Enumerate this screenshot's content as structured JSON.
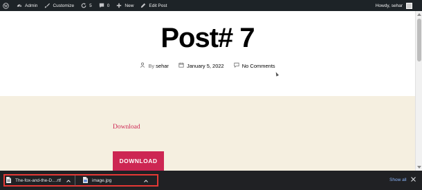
{
  "admin_bar": {
    "admin_label": "Admin",
    "customize_label": "Customize",
    "updates_count": "5",
    "comments_count": "0",
    "new_label": "New",
    "edit_post_label": "Edit Post",
    "howdy_label": "Howdy, sehar",
    "icons": [
      "wordpress-logo-icon",
      "dashboard-icon",
      "customize-brush-icon",
      "updates-icon",
      "comment-icon",
      "plus-icon",
      "pencil-icon"
    ]
  },
  "post": {
    "title": "Post# 7",
    "author_prefix": "By",
    "author": "sehar",
    "date": "January 5, 2022",
    "comments": "No Comments",
    "download_link_text": "Download",
    "download_button_label": "DOWNLOAD"
  },
  "download_shelf": {
    "items": [
      {
        "filename": "The-fox-and-the-D....rtf",
        "icon": "document-icon"
      },
      {
        "filename": "image.jpg",
        "icon": "image-file-icon"
      }
    ],
    "show_all_label": "Show all",
    "highlight_color": "#e53935"
  },
  "colors": {
    "admin_bar_bg": "#1d2327",
    "accent": "#cd2653",
    "beige_bg": "#f5efe0",
    "shelf_bg": "#202124",
    "link_blue": "#8ab4f8"
  }
}
